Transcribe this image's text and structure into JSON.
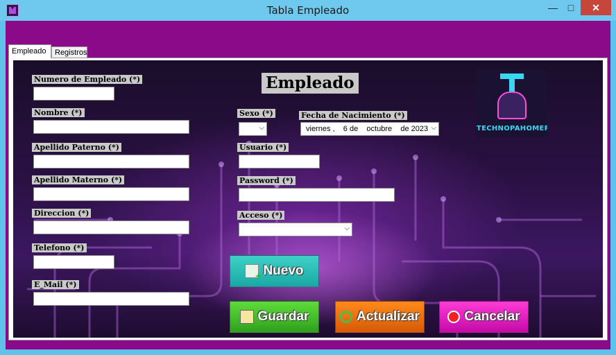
{
  "window": {
    "title": "Tabla Empleado",
    "minimize": "—",
    "maximize": "□",
    "close": "✕"
  },
  "tabs": [
    {
      "label": "Empleado",
      "active": true
    },
    {
      "label": "Registros",
      "active": false
    }
  ],
  "heading": "Empleado",
  "logo": {
    "text": "TECHNOPAHOMERO"
  },
  "labels": {
    "numero": "Numero de Empleado (*)",
    "nombre": "Nombre (*)",
    "paterno": "Apellido Paterno (*)",
    "materno": "Apellido Materno (*)",
    "direccion": "Direccion (*)",
    "telefono": "Telefono (*)",
    "email": "E_Mail (*)",
    "sexo": "Sexo (*)",
    "fecha": "Fecha de Nacimiento (*)",
    "usuario": "Usuario (*)",
    "password": "Password (*)",
    "acceso": "Acceso (*)"
  },
  "values": {
    "numero": "",
    "nombre": "",
    "paterno": "",
    "materno": "",
    "direccion": "",
    "telefono": "",
    "email": "",
    "sexo": "",
    "usuario": "",
    "password": "",
    "acceso": "",
    "fecha": "viernes ,    6 de    octubre    de 2023"
  },
  "buttons": {
    "nuevo": "Nuevo",
    "guardar": "Guardar",
    "actualizar": "Actualizar",
    "cancelar": "Cancelar"
  },
  "colors": {
    "titlebar": "#6fc9ee",
    "client": "#8a0a8a",
    "nuevo": "#2bbdb8",
    "guardar": "#3fbf28",
    "actualizar": "#f07212",
    "cancelar": "#e21ec0"
  }
}
